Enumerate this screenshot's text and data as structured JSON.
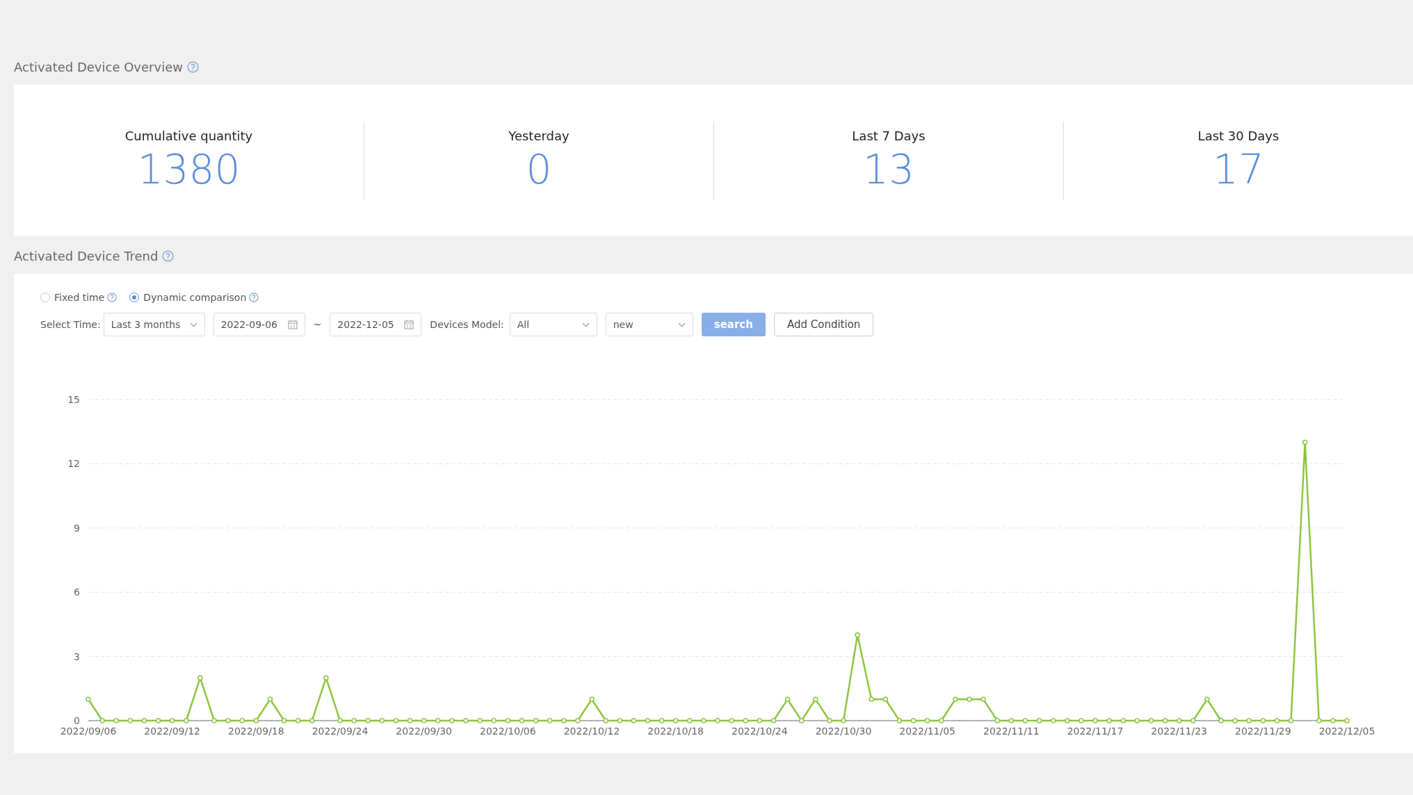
{
  "overview": {
    "title": "Activated Device Overview",
    "stats": [
      {
        "label": "Cumulative quantity",
        "value": "1380"
      },
      {
        "label": "Yesterday",
        "value": "0"
      },
      {
        "label": "Last 7 Days",
        "value": "13"
      },
      {
        "label": "Last 30 Days",
        "value": "17"
      }
    ]
  },
  "trend": {
    "title": "Activated Device Trend",
    "modes": [
      {
        "label": "Fixed time",
        "selected": false
      },
      {
        "label": "Dynamic comparison",
        "selected": true
      }
    ],
    "filters": {
      "time_label": "Select Time:",
      "range": "Last 3 months",
      "start_date": "2022-09-06",
      "separator": "~",
      "end_date": "2022-12-05",
      "model_label": "Devices Model:",
      "model": "All",
      "type": "new",
      "search_button": "search",
      "add_button": "Add Condition"
    },
    "chart_data": {
      "type": "line",
      "grid": true,
      "categories": [
        "2022/09/06",
        null,
        null,
        null,
        null,
        null,
        "2022/09/12",
        null,
        null,
        null,
        null,
        null,
        "2022/09/18",
        null,
        null,
        null,
        null,
        null,
        "2022/09/24",
        null,
        null,
        null,
        null,
        null,
        "2022/09/30",
        null,
        null,
        null,
        null,
        null,
        "2022/10/06",
        null,
        null,
        null,
        null,
        null,
        "2022/10/12",
        null,
        null,
        null,
        null,
        null,
        "2022/10/18",
        null,
        null,
        null,
        null,
        null,
        "2022/10/24",
        null,
        null,
        null,
        null,
        null,
        "2022/10/30",
        null,
        null,
        null,
        null,
        null,
        "2022/11/05",
        null,
        null,
        null,
        null,
        null,
        "2022/11/11",
        null,
        null,
        null,
        null,
        null,
        "2022/11/17",
        null,
        null,
        null,
        null,
        null,
        "2022/11/23",
        null,
        null,
        null,
        null,
        null,
        "2022/11/29",
        null,
        null,
        null,
        null,
        null,
        "2022/12/05"
      ],
      "series": [
        {
          "color": "#8cc63f",
          "marker": "circle",
          "values": [
            1,
            0,
            0,
            0,
            0,
            0,
            0,
            0,
            2,
            0,
            0,
            0,
            0,
            1,
            0,
            0,
            0,
            2,
            0,
            0,
            0,
            0,
            0,
            0,
            0,
            0,
            0,
            0,
            0,
            0,
            0,
            0,
            0,
            0,
            0,
            0,
            1,
            0,
            0,
            0,
            0,
            0,
            0,
            0,
            0,
            0,
            0,
            0,
            0,
            0,
            1,
            0,
            1,
            0,
            0,
            4,
            1,
            1,
            0,
            0,
            0,
            0,
            1,
            1,
            1,
            0,
            0,
            0,
            0,
            0,
            0,
            0,
            0,
            0,
            0,
            0,
            0,
            0,
            0,
            0,
            1,
            0,
            0,
            0,
            0,
            0,
            0,
            13,
            0,
            0,
            0
          ]
        }
      ],
      "ylim": [
        0,
        15
      ],
      "yticks": [
        0,
        3,
        6,
        9,
        12,
        15
      ]
    }
  }
}
